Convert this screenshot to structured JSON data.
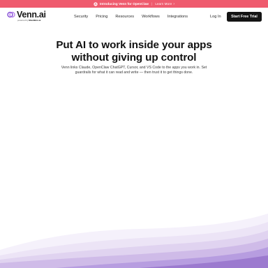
{
  "announcement": {
    "text": "Introducing Venn for OpenClaw",
    "link": "Learn More",
    "bg": "#ef5b6e"
  },
  "brand": {
    "name": "Venn.ai",
    "tagline_prefix": "powered by",
    "tagline_company": "BlackBox.ai",
    "logo_color": "#7a3fd1"
  },
  "nav": {
    "items": [
      "Security",
      "Pricing",
      "Resources",
      "Workflows",
      "Integrations"
    ],
    "login": "Log In",
    "cta": "Start Free Trial"
  },
  "hero": {
    "title_line1": "Put AI to work inside your apps",
    "title_line2": "without giving up control",
    "subtitle": "Venn links Claude, OpenClaw ChatGPT, Cursor, and VS Code to the apps you work in. Set guardrails for what it can read and write — then trust it to get things done."
  },
  "colors": {
    "wave_light": "#f3effb",
    "wave_mid": "#e1d6f1",
    "wave_deep": "#b49ad8",
    "wave_darkest": "#8f6fc4"
  }
}
